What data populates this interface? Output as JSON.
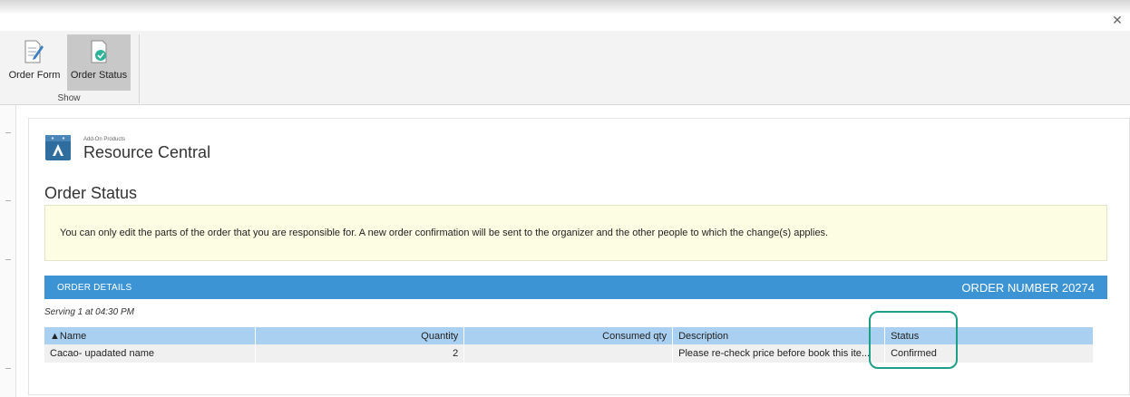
{
  "window": {
    "close_glyph": "✕"
  },
  "ribbon": {
    "buttons": [
      {
        "label": "Order Form",
        "icon": "order-form-icon"
      },
      {
        "label": "Order Status",
        "icon": "order-status-icon"
      }
    ],
    "group_label": "Show"
  },
  "brand": {
    "small_text": "Add-On Products",
    "title": "Resource Central",
    "color": "#2f6d9e"
  },
  "page": {
    "title": "Order Status",
    "notice": "You can only edit the parts of the order that you are responsible for. A new order confirmation will be sent to the organizer and the other people to which the change(s) applies."
  },
  "order": {
    "section_label": "ORDER DETAILS",
    "number_label": "ORDER NUMBER 20274",
    "serving": "Serving 1 at 04:30 PM",
    "columns": [
      "▲Name",
      "Quantity",
      "Consumed qty",
      "Description",
      "Status"
    ],
    "rows": [
      {
        "name": "Cacao- upadated name",
        "quantity": "2",
        "consumed": "",
        "description": "Please re-check price before book this ite...",
        "status": "Confirmed"
      }
    ]
  },
  "colors": {
    "accent": "#3d94d4",
    "header_row": "#a9d0f1",
    "notice_bg": "#fdfde3",
    "highlight": "#1e9e86"
  }
}
